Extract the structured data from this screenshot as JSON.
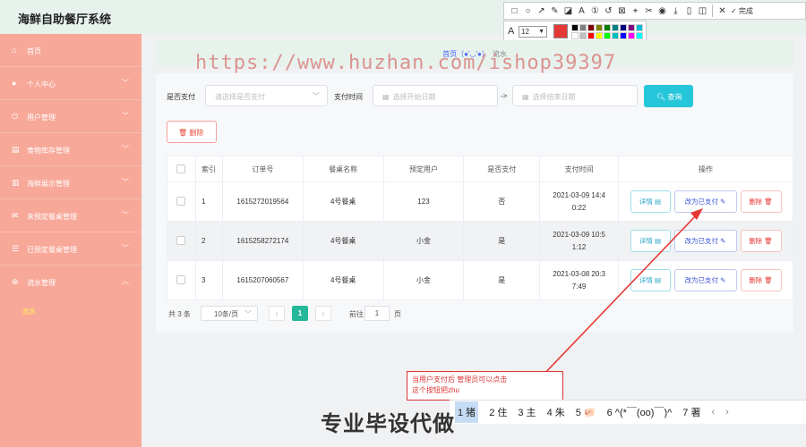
{
  "app": {
    "title": "海鲜自助餐厅系统"
  },
  "toolbar": {
    "tools": [
      "□",
      "○",
      "↗",
      "✎",
      "◪",
      "A",
      "①",
      "↺",
      "⊠",
      "⌖",
      "✂",
      "◉",
      "⤓",
      "▯",
      "◫"
    ],
    "done_label": "✓ 完成",
    "font_size": "12",
    "swatch_colors": [
      "#000000",
      "#808080",
      "#800000",
      "#808000",
      "#008000",
      "#008080",
      "#000080",
      "#800080",
      "#00bcd4",
      "#ffffff",
      "#c0c0c0",
      "#ff0000",
      "#ffff00",
      "#00ff00",
      "#00c0c0",
      "#0000ff",
      "#ff00ff",
      "#00ffff"
    ]
  },
  "sidebar": {
    "items": [
      {
        "icon": "⌂",
        "icon_name": "home-icon",
        "label": "首页"
      },
      {
        "icon": "●",
        "icon_name": "user-icon",
        "label": "个人中心"
      },
      {
        "icon": "⏻",
        "icon_name": "power-icon",
        "label": "用户管理"
      },
      {
        "icon": "▤",
        "icon_name": "inventory-icon",
        "label": "食物库存管理"
      },
      {
        "icon": "▥",
        "icon_name": "display-icon",
        "label": "海鲜展示管理"
      },
      {
        "icon": "✉",
        "icon_name": "mail-icon",
        "label": "未预定餐桌管理"
      },
      {
        "icon": "☰",
        "icon_name": "list-icon",
        "label": "已预定餐桌管理"
      },
      {
        "icon": "⊗",
        "icon_name": "flow-icon",
        "label": "流水管理"
      }
    ],
    "sub_item": "流水"
  },
  "breadcrumb": {
    "home": "首页（●'◡'●）",
    "current": "流水"
  },
  "filters": {
    "paid_label": "是否支付",
    "paid_placeholder": "请选择是否支付",
    "time_label": "支付时间",
    "start_placeholder": "选择开始日期",
    "separator": "->",
    "end_placeholder": "选择结束日期",
    "search_label": "查询",
    "delete_label": "删除"
  },
  "table": {
    "headers": [
      "索引",
      "订单号",
      "餐桌名称",
      "预定用户",
      "是否支付",
      "支付时间",
      "操作"
    ],
    "rows": [
      {
        "index": "1",
        "order": "1615272019564",
        "table_name": "4号餐桌",
        "user": "123",
        "paid": "否",
        "time_a": "2021-03-09 14:4",
        "time_b": "0:22"
      },
      {
        "index": "2",
        "order": "1615258272174",
        "table_name": "4号餐桌",
        "user": "小金",
        "paid": "是",
        "time_a": "2021-03-09 10:5",
        "time_b": "1:12"
      },
      {
        "index": "3",
        "order": "1615207060567",
        "table_name": "4号餐桌",
        "user": "小金",
        "paid": "是",
        "time_a": "2021-03-08 20:3",
        "time_b": "7:49"
      }
    ],
    "actions": {
      "detail": "详情 ▤",
      "mark_paid": "改为已支付 ✎",
      "delete": "删除 🗑"
    }
  },
  "pagination": {
    "total": "共 3 条",
    "page_size": "10条/页",
    "current_page": "1",
    "goto_label": "前往",
    "goto_value": "1",
    "goto_suffix": "页"
  },
  "overlay": {
    "watermark": "https://www.huzhan.com/ishop39397",
    "callout_line1": "当用户支付后 管理员可以点击",
    "callout_line2": "这个按钮把zhu",
    "ime_candidates": [
      "1 猪",
      "2 住",
      "3 主",
      "4 朱",
      "5 🐖",
      "6 ^(*￣(oo)￣)^",
      "7 著"
    ],
    "banner": "专业毕设代做"
  }
}
